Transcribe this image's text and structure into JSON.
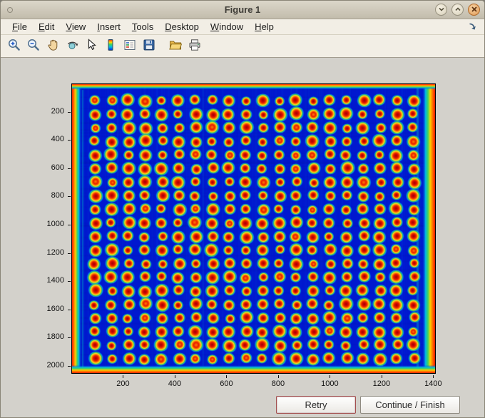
{
  "window": {
    "title": "Figure 1",
    "controls": [
      "minimize",
      "maximize",
      "close"
    ]
  },
  "menu_bar": {
    "items": [
      "File",
      "Edit",
      "View",
      "Insert",
      "Tools",
      "Desktop",
      "Window",
      "Help"
    ]
  },
  "toolbar": {
    "tools": [
      "zoom-in",
      "zoom-out",
      "pan",
      "rotate-3d",
      "data-cursor",
      "insert-colorbar",
      "insert-legend",
      "save-figure",
      "open-file",
      "print-figure"
    ]
  },
  "chart_data": {
    "type": "heatmap",
    "title": "",
    "xlabel": "",
    "ylabel": "",
    "x_ticks": [
      200,
      400,
      600,
      800,
      1000,
      1200,
      1400
    ],
    "y_ticks": [
      200,
      400,
      600,
      800,
      1000,
      1200,
      1400,
      1600,
      1800,
      2000
    ],
    "x_range": [
      0,
      1410
    ],
    "y_range": [
      0,
      2056
    ],
    "colormap": "jet",
    "description": "Microarray scan image rendered with jet colormap: deep blue background, regular grid of red-orange spots with yellow-green halos, saturated red/orange/yellow bands along all four image edges",
    "spot_grid": {
      "rows": 20,
      "cols": 20
    },
    "colors": {
      "background": "#0018cf",
      "spot_core": "#a80000",
      "spot_mid": "#ff8800",
      "spot_ring": "#ffe12a",
      "halo": "#35c94f",
      "edge_band": "#ff1a00"
    }
  },
  "action_buttons": {
    "retry": "Retry",
    "continue_finish": "Continue / Finish"
  }
}
